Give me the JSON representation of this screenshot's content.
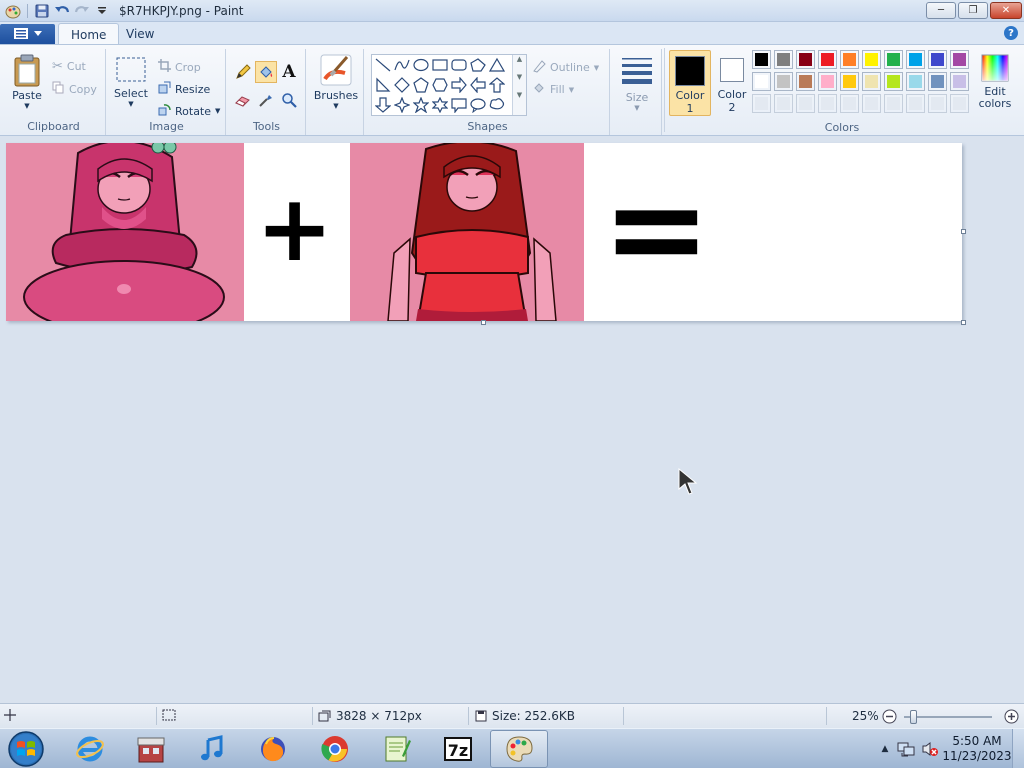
{
  "window": {
    "title": "$R7HKPJY.png - Paint",
    "min_label": "─",
    "max_label": "❐",
    "close_label": "✕"
  },
  "tabs": [
    {
      "label": "Home",
      "active": true
    },
    {
      "label": "View",
      "active": false
    }
  ],
  "help_label": "?",
  "ribbon": {
    "clipboard": {
      "group": "Clipboard",
      "paste": "Paste",
      "cut": "Cut",
      "copy": "Copy"
    },
    "image": {
      "group": "Image",
      "select": "Select",
      "crop": "Crop",
      "resize": "Resize",
      "rotate": "Rotate"
    },
    "tools": {
      "group": "Tools"
    },
    "brushes": {
      "label": "Brushes"
    },
    "shapes": {
      "group": "Shapes",
      "outline": "Outline",
      "fill": "Fill"
    },
    "size": {
      "label": "Size"
    },
    "color1": {
      "label1": "Color",
      "label2": "1",
      "value": "#000000"
    },
    "color2": {
      "label1": "Color",
      "label2": "2",
      "value": "#ffffff"
    },
    "colors": {
      "group": "Colors",
      "edit1": "Edit",
      "edit2": "colors",
      "palette_row1": [
        "#000000",
        "#7f7f7f",
        "#880015",
        "#ed1c24",
        "#ff7f27",
        "#fff200",
        "#22b14c",
        "#00a2e8",
        "#3f48cc",
        "#a349a4"
      ],
      "palette_row2": [
        "#ffffff",
        "#c3c3c3",
        "#b97a57",
        "#ffaec9",
        "#ffc90e",
        "#efe4b0",
        "#b5e61d",
        "#99d9ea",
        "#7092be",
        "#c8bfe7"
      ]
    }
  },
  "canvas": {
    "plus_symbol": "+",
    "equals_symbol": "="
  },
  "status": {
    "dimensions": "3828 × 712px",
    "size": "Size: 252.6KB",
    "zoom": "25%"
  },
  "taskbar": {
    "time": "5:50 AM",
    "date": "11/23/2023"
  }
}
